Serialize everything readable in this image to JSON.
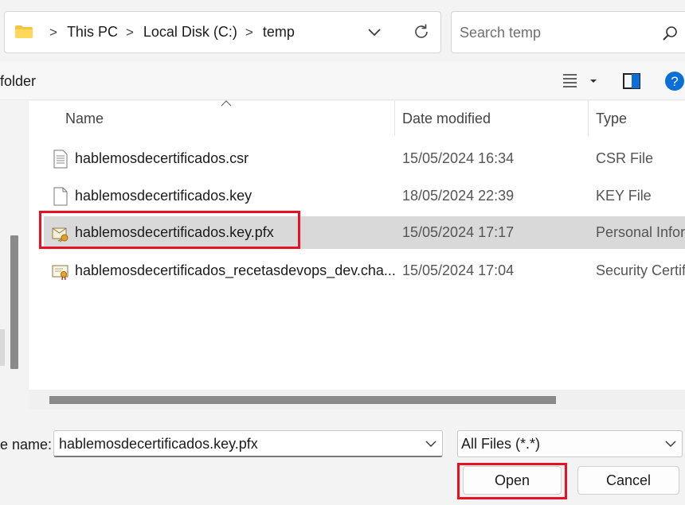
{
  "address_bar": {
    "icon": "folder-icon",
    "breadcrumbs": [
      "This PC",
      "Local Disk (C:)",
      "temp"
    ]
  },
  "search": {
    "placeholder": "Search temp"
  },
  "command_bar": {
    "new_folder_label": "folder"
  },
  "columns": {
    "name": "Name",
    "date": "Date modified",
    "type": "Type"
  },
  "files": [
    {
      "name": "hablemosdecertificados.csr",
      "date": "15/05/2024 16:34",
      "type": "CSR File",
      "icon": "text-file-icon",
      "selected": false
    },
    {
      "name": "hablemosdecertificados.key",
      "date": "18/05/2024 22:39",
      "type": "KEY File",
      "icon": "blank-file-icon",
      "selected": false
    },
    {
      "name": "hablemosdecertificados.key.pfx",
      "date": "15/05/2024 17:17",
      "type": "Personal Inforn",
      "icon": "pfx-certificate-icon",
      "selected": true
    },
    {
      "name": "hablemosdecertificados_recetasdevops_dev.cha...",
      "date": "15/05/2024 17:04",
      "type": "Security Certifi",
      "icon": "security-certificate-icon",
      "selected": false
    }
  ],
  "bottom": {
    "file_name_label": "e name:",
    "file_name_value": "hablemosdecertificados.key.pfx",
    "file_type_value": "All Files (*.*)",
    "open_label": "Open",
    "cancel_label": "Cancel"
  },
  "colors": {
    "highlight": "#e81123",
    "selection": "#d9d9d9",
    "help_blue": "#0067c0"
  }
}
